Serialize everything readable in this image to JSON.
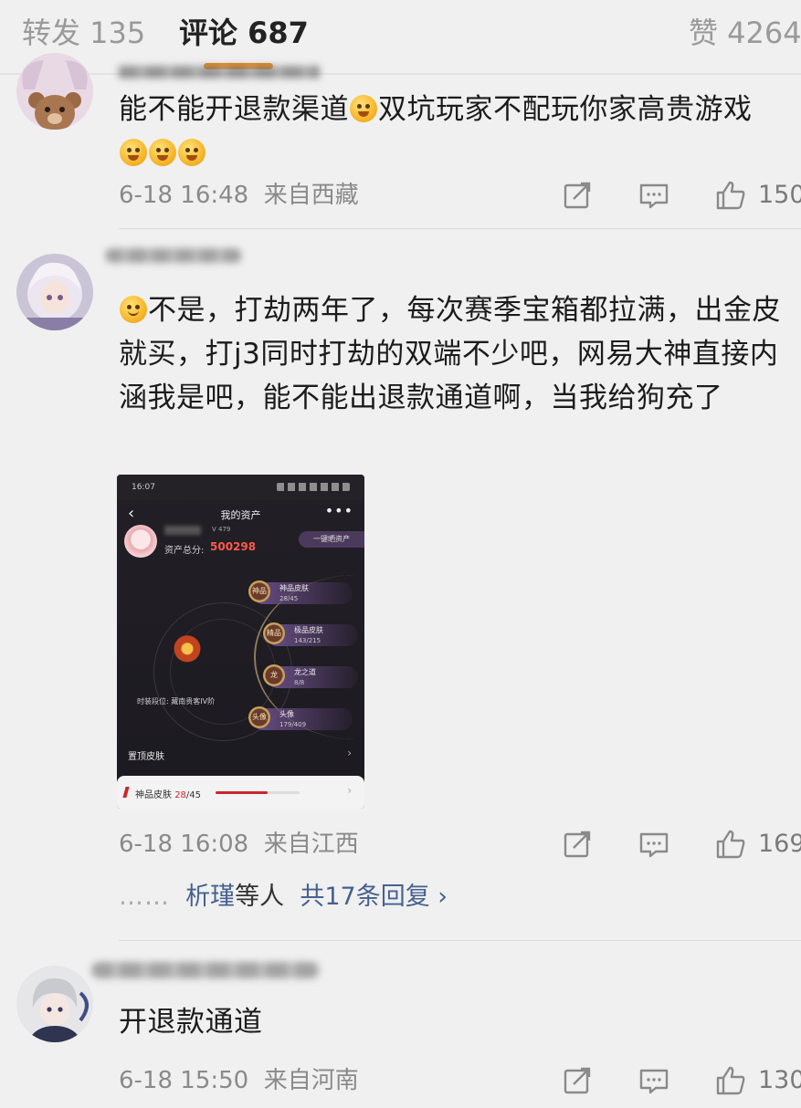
{
  "tabs": {
    "reposts": "转发 135",
    "comments": "评论 687",
    "likes": "赞 4264"
  },
  "comments": [
    {
      "text": "能不能开退款渠道",
      "text_after_emoji": "双坑玩家不配玩你家高贵游戏",
      "time": "6-18 16:48",
      "location": "来自西藏",
      "like_count": "150"
    },
    {
      "text": "不是，打劫两年了，每次赛季宝箱都拉满，出金皮就买，打j3同时打劫的双端不少吧，网易大神直接内涵我是吧，能不能出退款通道啊，当我给狗充了",
      "time": "6-18 16:08",
      "location": "来自江西",
      "like_count": "169",
      "replies": {
        "dots": "……",
        "name": "析瑾",
        "suffix": "等人",
        "count_link": "共17条回复 ›"
      },
      "screenshot": {
        "status_time": "16:07",
        "title": "我的资产",
        "more": "•••",
        "level": "V 479",
        "score_label": "资产总分:",
        "score": "500298",
        "share_button": "一键晒资产",
        "nodes": [
          {
            "badge": "神品",
            "name": "神品皮肤",
            "count": "28/45"
          },
          {
            "badge": "精品",
            "name": "极品皮肤",
            "count": "143/215"
          },
          {
            "badge": "龙",
            "name": "龙之道",
            "count": "8/8"
          },
          {
            "badge": "头像",
            "name": "头像",
            "count": "179/409"
          }
        ],
        "rank": "时装段位: 藏南贵客IV阶",
        "pin": "置顶皮肤",
        "card_label": "神品皮肤",
        "card_value": "28",
        "card_total": "/45",
        "card_progress": 0.62
      }
    },
    {
      "text": "开退款通道",
      "time": "6-18 15:50",
      "location": "来自河南",
      "like_count": "130"
    }
  ],
  "colors": {
    "accent_underline": "#ec8b1a",
    "link_blue": "#46618f",
    "score_red": "#ff5a47"
  },
  "icons": [
    "repost-icon",
    "comment-icon",
    "like-icon"
  ]
}
